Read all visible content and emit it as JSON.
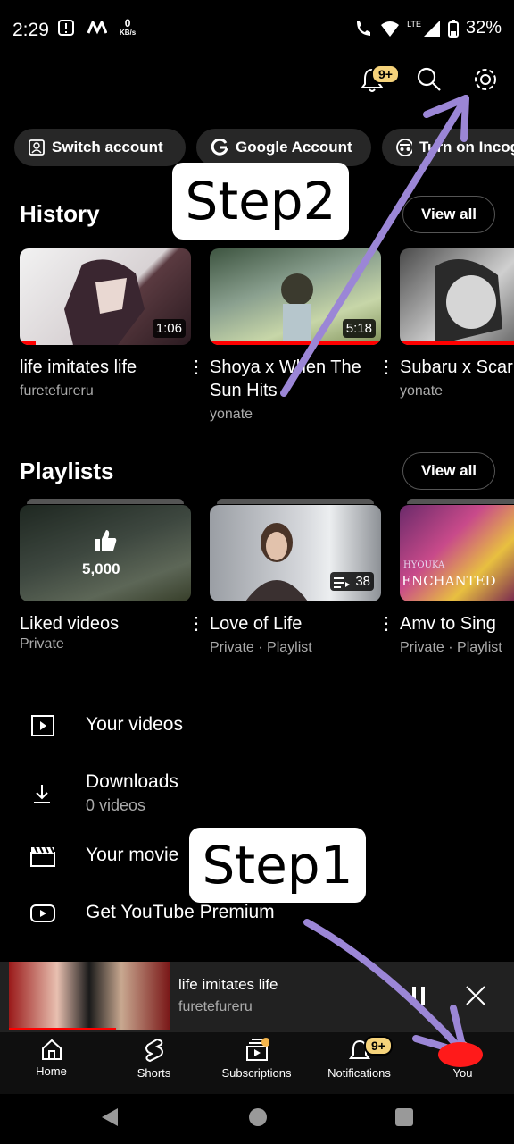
{
  "status": {
    "time": "2:29",
    "net_speed": "0",
    "net_unit": "KB/s",
    "network": "LTE",
    "battery": "32%"
  },
  "top": {
    "notif_badge": "9+"
  },
  "chips": [
    {
      "label": "Switch account",
      "icon": "switch-account-icon"
    },
    {
      "label": "Google Account",
      "icon": "google-icon"
    },
    {
      "label": "Turn on Incog",
      "icon": "incognito-icon"
    }
  ],
  "history": {
    "title": "History",
    "view_all": "View all",
    "items": [
      {
        "title": "life imitates life",
        "channel": "furetefureru",
        "duration": "1:06"
      },
      {
        "title": "Shoya x When The Sun Hits",
        "channel": "yonate",
        "duration": "5:18"
      },
      {
        "title": "Subaru x Scar",
        "channel": "yonate",
        "duration": ""
      }
    ]
  },
  "playlists": {
    "title": "Playlists",
    "view_all": "View all",
    "items": [
      {
        "title": "Liked videos",
        "sub": "Private",
        "count": "5,000"
      },
      {
        "title": "Love of Life",
        "sub": "Private · Playlist",
        "count": "38"
      },
      {
        "title": "Amv to Sing",
        "sub": "Private · Playlist",
        "count": ""
      }
    ],
    "thumb3_text_1": "HYOUKA",
    "thumb3_text_2": "ENCHANTED"
  },
  "menu": [
    {
      "label": "Your videos",
      "sub": "",
      "icon": "play-square-icon"
    },
    {
      "label": "Downloads",
      "sub": "0 videos",
      "icon": "download-icon"
    },
    {
      "label": "Your movie",
      "sub": "",
      "icon": "clapperboard-icon"
    },
    {
      "label": "Get YouTube Premium",
      "sub": "",
      "icon": "youtube-icon"
    }
  ],
  "mini_player": {
    "title": "life imitates life",
    "channel": "furetefureru"
  },
  "nav": [
    {
      "label": "Home",
      "icon": "home-icon"
    },
    {
      "label": "Shorts",
      "icon": "shorts-icon"
    },
    {
      "label": "Subscriptions",
      "icon": "subscriptions-icon"
    },
    {
      "label": "Notifications",
      "icon": "bell-icon",
      "badge": "9+"
    },
    {
      "label": "You",
      "icon": "you-icon"
    }
  ],
  "annotations": {
    "step1": "Step1",
    "step2": "Step2",
    "arrow_color": "#9b86d6",
    "marker_color": "#ff1a1a"
  }
}
